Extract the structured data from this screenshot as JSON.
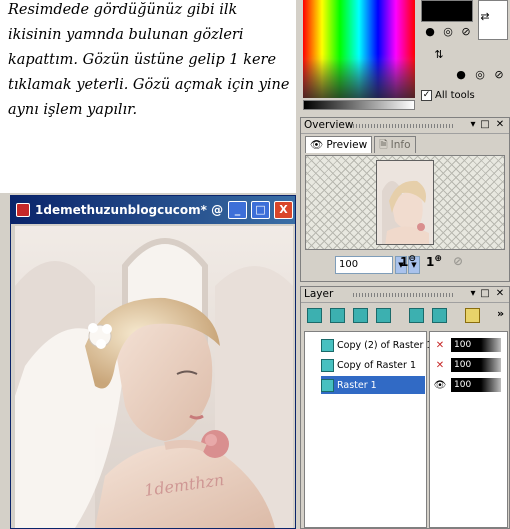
{
  "instruction": {
    "lines": [
      "Resimdede gördüğünüz gibi ilk",
      "ikisinin yamnda bulunan gözleri",
      "kapattım. Gözün üstüne gelip 1 kere",
      "tıklamak yeterli. Gözü açmak için yine",
      "aynı işlem yapılır."
    ]
  },
  "image_window": {
    "title": "1demethuzunblogcucom* @ ...",
    "minimize": "_",
    "maximize": "□",
    "close": "X",
    "watermark": "1demthzn"
  },
  "materials": {
    "all_tools_label": "All tools",
    "all_tools_checked": true
  },
  "overview": {
    "title": "Overview",
    "tabs": [
      {
        "label": "Preview",
        "active": true
      },
      {
        "label": "Info",
        "active": false
      }
    ],
    "zoom_value": "100",
    "zoom_in_label": "1",
    "zoom_out_label": "1"
  },
  "layers": {
    "title": "Layer",
    "items": [
      {
        "name": "Copy (2) of Raster 1",
        "visible": false,
        "opacity": "100",
        "selected": false
      },
      {
        "name": "Copy of Raster 1",
        "visible": false,
        "opacity": "100",
        "selected": false
      },
      {
        "name": "Raster 1",
        "visible": true,
        "opacity": "100",
        "selected": true
      }
    ]
  },
  "colors": {
    "titlebar": "#0a246a",
    "selection": "#316ac5",
    "panel_bg": "#d4d0c8"
  }
}
